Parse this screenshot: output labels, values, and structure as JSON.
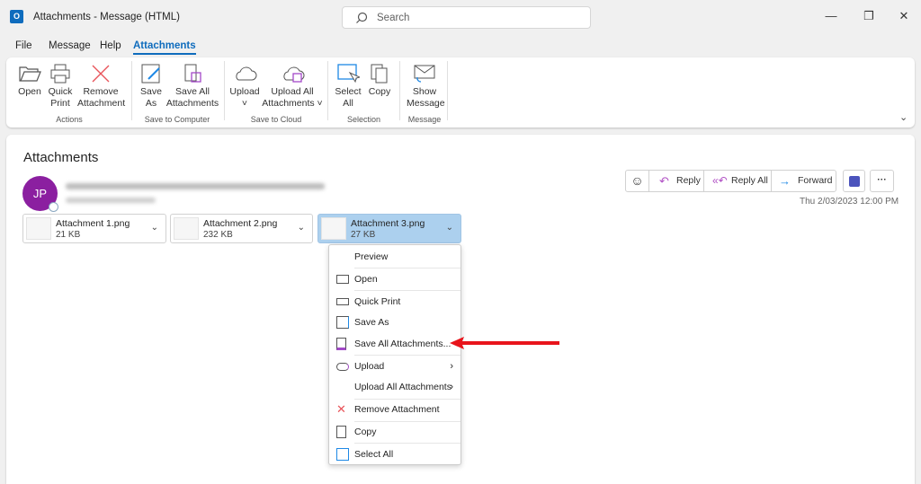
{
  "window": {
    "title": "Attachments  -  Message (HTML)",
    "search_placeholder": "Search",
    "logo": "O"
  },
  "tabs": [
    "File",
    "Message",
    "Help",
    "Attachments"
  ],
  "ribbon": {
    "buttons": [
      {
        "l1": "Open",
        "l2": ""
      },
      {
        "l1": "Quick",
        "l2": "Print"
      },
      {
        "l1": "Remove",
        "l2": "Attachment"
      },
      {
        "l1": "Save",
        "l2": "As"
      },
      {
        "l1": "Save All",
        "l2": "Attachments"
      },
      {
        "l1": "Upload",
        "l2": "˅"
      },
      {
        "l1": "Upload All",
        "l2": "Attachments ˅"
      },
      {
        "l1": "Select",
        "l2": "All"
      },
      {
        "l1": "Copy",
        "l2": ""
      },
      {
        "l1": "Show",
        "l2": "Message"
      }
    ],
    "groups": [
      "Actions",
      "Save to Computer",
      "Save to Cloud",
      "Selection",
      "Message"
    ]
  },
  "message": {
    "heading": "Attachments",
    "avatar_initials": "JP",
    "date": "Thu 2/03/2023 12:00 PM",
    "actions": [
      "Reply",
      "Reply All",
      "Forward"
    ]
  },
  "attachments": [
    {
      "name": "Attachment 1.png",
      "size": "21 KB"
    },
    {
      "name": "Attachment 2.png",
      "size": "232 KB"
    },
    {
      "name": "Attachment 3.png",
      "size": "27 KB"
    }
  ],
  "menu": [
    "Preview",
    "Open",
    "Quick Print",
    "Save As",
    "Save All Attachments...",
    "Upload",
    "Upload All Attachments",
    "Remove Attachment",
    "Copy",
    "Select All"
  ],
  "colors": {
    "accent": "#0f6cbd",
    "avatar": "#8b1fa0",
    "selected": "#acd0ee",
    "arrow": "#e8141b"
  }
}
